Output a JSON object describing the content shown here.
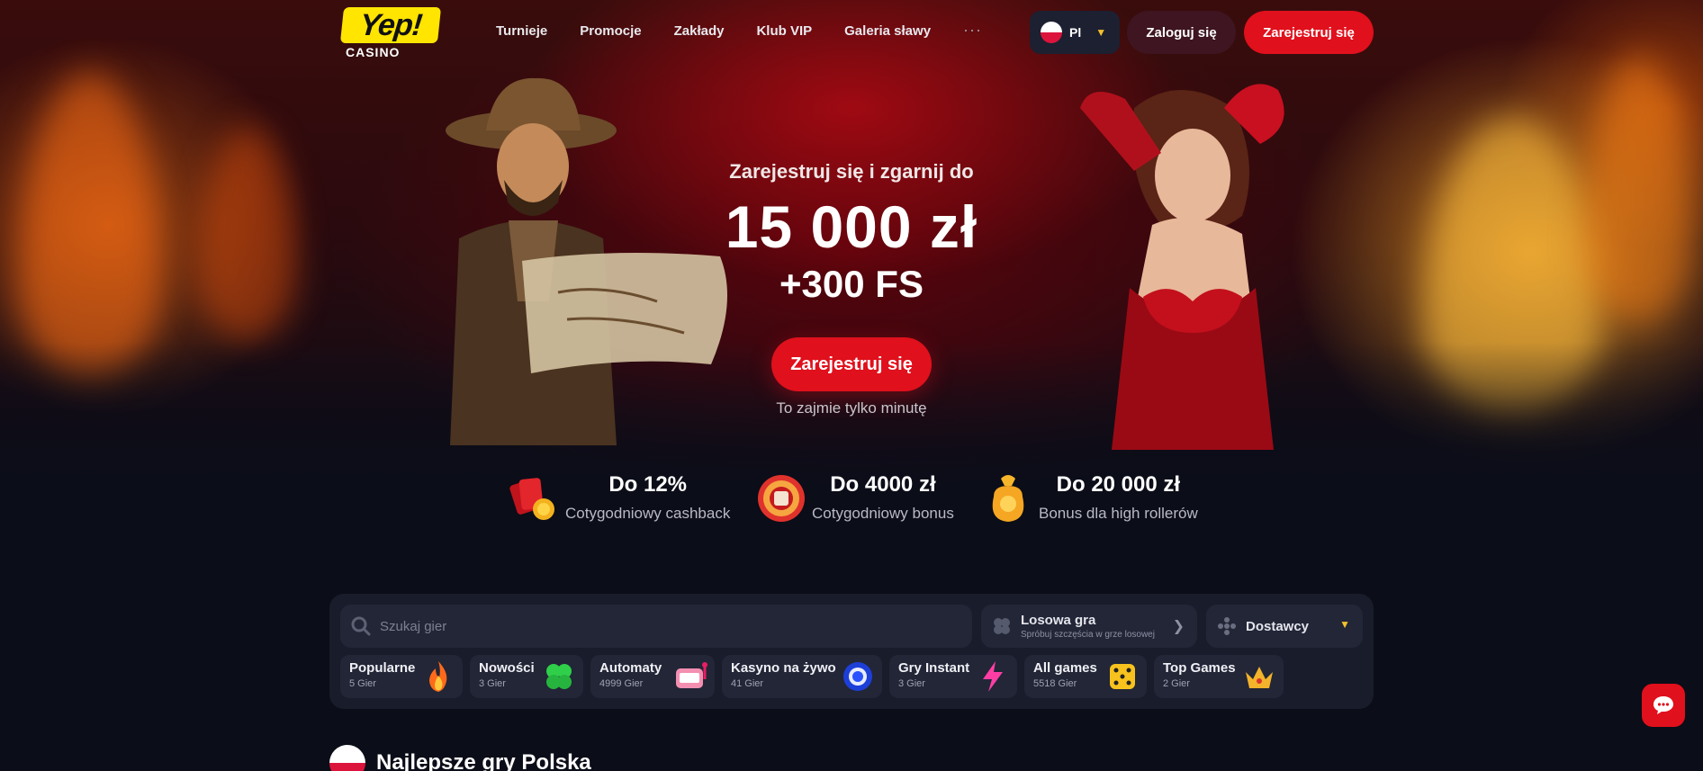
{
  "header": {
    "logo_text": "Yep!",
    "logo_sub": "CASINO",
    "nav": [
      {
        "label": "Turnieje"
      },
      {
        "label": "Promocje"
      },
      {
        "label": "Zakłady"
      },
      {
        "label": "Klub VIP"
      },
      {
        "label": "Galeria sławy"
      }
    ],
    "more_label": "···",
    "language": {
      "code": "Pl",
      "icon": "poland-flag-icon"
    },
    "login_label": "Zaloguj się",
    "register_label": "Zarejestruj się"
  },
  "hero": {
    "subtitle": "Zarejestruj się i zgarnij do",
    "amount": "15 000 zł",
    "free_spins": "+300 FS",
    "cta_label": "Zarejestruj się",
    "note": "To zajmie tylko minutę"
  },
  "benefits": [
    {
      "title": "Do 12%",
      "desc": "Cotygodniowy cashback",
      "icon": "cashback-icon"
    },
    {
      "title": "Do 4000 zł",
      "desc": "Cotygodniowy bonus",
      "icon": "bonus-wheel-icon"
    },
    {
      "title": "Do 20 000 zł",
      "desc": "Bonus dla high rollerów",
      "icon": "money-bag-icon"
    }
  ],
  "games_panel": {
    "search_placeholder": "Szukaj gier",
    "random": {
      "title": "Losowa gra",
      "subtitle": "Spróbuj szczęścia w grze losowej"
    },
    "providers_label": "Dostawcy",
    "categories": [
      {
        "name": "Popularne",
        "count": "5 Gier",
        "icon": "fire-icon"
      },
      {
        "name": "Nowości",
        "count": "3 Gier",
        "icon": "clover-icon"
      },
      {
        "name": "Automaty",
        "count": "4999 Gier",
        "icon": "slot-machine-icon"
      },
      {
        "name": "Kasyno na żywo",
        "count": "41 Gier",
        "icon": "casino-chip-icon"
      },
      {
        "name": "Gry Instant",
        "count": "3 Gier",
        "icon": "lightning-icon"
      },
      {
        "name": "All games",
        "count": "5518 Gier",
        "icon": "dice-icon"
      },
      {
        "name": "Top Games",
        "count": "2 Gier",
        "icon": "crown-icon"
      }
    ]
  },
  "section": {
    "title": "Najlepsze gry Polska"
  },
  "colors": {
    "accent": "#e0101c",
    "logo_yellow": "#ffe500",
    "panel": "#191c2a",
    "background": "#0b0d18"
  }
}
